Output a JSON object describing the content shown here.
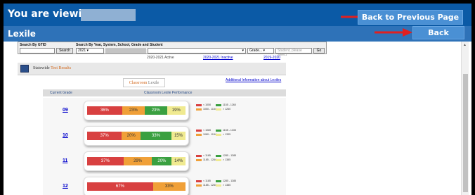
{
  "header": {
    "viewing_label": "You are viewing as",
    "back_prev_label": "Back to Previous Page",
    "subtitle": "Lexile",
    "back_label": "Back"
  },
  "search": {
    "by_gtid_label": "Search By GTID",
    "by_year_label": "Search By Year, System, School, Grade and Student",
    "search_button": "Search",
    "year_value": "2021",
    "grade_value": "Grade...",
    "student_placeholder": "Student, please select",
    "go_button": "Go"
  },
  "years": {
    "active": "2020-2021 Active",
    "link1": "2020-2021 Inactive",
    "link2": "2019-2020"
  },
  "statewide": {
    "label_prefix": "Statewide",
    "label_accent": "Test Results"
  },
  "tab": {
    "classroom": "Classroom",
    "lexile": "Lexile"
  },
  "additional_info": "Additional Information about Lexiles",
  "table": {
    "col_grade": "Current Grade",
    "col_perf": "Classroom Lexile Performance",
    "rows": [
      {
        "grade": "09",
        "segments": [
          {
            "pct": 36,
            "label": "36%",
            "color": "#d84040"
          },
          {
            "pct": 23,
            "label": "23%",
            "color": "#f0a038"
          },
          {
            "pct": 23,
            "label": "23%",
            "color": "#3aa040"
          },
          {
            "pct": 19,
            "label": "19%",
            "color": "#f0ea90"
          }
        ],
        "legend": [
          "< 1050",
          "1050 - 1154",
          "1155 - 1260",
          "> 1260"
        ]
      },
      {
        "grade": "10",
        "segments": [
          {
            "pct": 37,
            "label": "37%",
            "color": "#d84040"
          },
          {
            "pct": 20,
            "label": "20%",
            "color": "#f0a038"
          },
          {
            "pct": 33,
            "label": "33%",
            "color": "#3aa040"
          },
          {
            "pct": 15,
            "label": "15%",
            "color": "#f0ea90"
          }
        ],
        "legend": [
          "< 1080",
          "1080 - 1154",
          "1155 - 1335",
          "> 1335"
        ]
      },
      {
        "grade": "11",
        "segments": [
          {
            "pct": 37,
            "label": "37%",
            "color": "#d84040"
          },
          {
            "pct": 29,
            "label": "29%",
            "color": "#f0a038"
          },
          {
            "pct": 20,
            "label": "20%",
            "color": "#3aa040"
          },
          {
            "pct": 14,
            "label": "14%",
            "color": "#f0ea90"
          }
        ],
        "legend": [
          "< 1185",
          "1185 - 1284",
          "1285 - 1385",
          "> 1385"
        ]
      },
      {
        "grade": "12",
        "segments": [
          {
            "pct": 67,
            "label": "67%",
            "color": "#d84040"
          },
          {
            "pct": 33,
            "label": "33%",
            "color": "#f0a038"
          }
        ],
        "legend": [
          "< 1185",
          "1185 - 1284",
          "1285 - 1385",
          "> 1385"
        ]
      }
    ]
  }
}
